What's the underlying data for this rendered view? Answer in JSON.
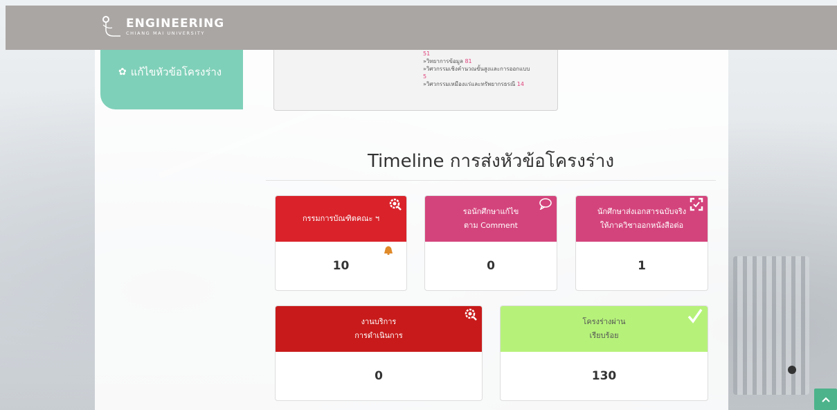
{
  "header": {
    "logo_main": "ENGINEERING",
    "logo_sub": "CHIANG MAI UNIVERSITY"
  },
  "sidebar": {
    "items": [
      {
        "label": "แก้ไขหัวข้อโครงร่าง",
        "icon": "gear-icon"
      }
    ]
  },
  "stats": {
    "lines": [
      {
        "text": "",
        "value": "51"
      },
      {
        "text": "»วิทยาการข้อมูล",
        "value": "81"
      },
      {
        "text": "»วิศวกรรมเชิงคำนวณขั้นสูงและการออกแบบ",
        "value": ""
      },
      {
        "text": "",
        "value": "5"
      },
      {
        "text": "»วิศวกรรมเหมืองแร่และทรัพยากรธรณี",
        "value": "14"
      }
    ]
  },
  "timeline": {
    "title": "Timeline การส่งหัวข้อโครงร่าง",
    "cards": [
      {
        "line1": "กรรมการบัณฑิตคณะ ฯ",
        "line2": "",
        "value": "10",
        "color": "#d9222a",
        "icon": "search-gear-icon"
      },
      {
        "line1": "รอนักศึกษาแก้ไข",
        "line2": "ตาม Comment",
        "value": "0",
        "color": "#d4447c",
        "icon": "comment-icon"
      },
      {
        "line1": "นักศึกษาส่งเอกสารฉบับจริง",
        "line2": "ให้ภาควิชาออกหนังสือต่อ",
        "value": "1",
        "color": "#d4447c",
        "icon": "expand-icon"
      },
      {
        "line1": "งานบริการ",
        "line2": "การดำเนินการ",
        "value": "0",
        "color": "#c81a1a",
        "icon": "search-gear-icon"
      },
      {
        "line1": "โครงร่างผ่าน",
        "line2": "เรียบร้อย",
        "value": "130",
        "color": "#b6f27a",
        "icon": "check-icon"
      }
    ]
  },
  "colors": {
    "header_bg": "#aaa6a4",
    "sidebar_bg": "#7fd0b8",
    "scroll_top_bg": "#4db38a"
  }
}
